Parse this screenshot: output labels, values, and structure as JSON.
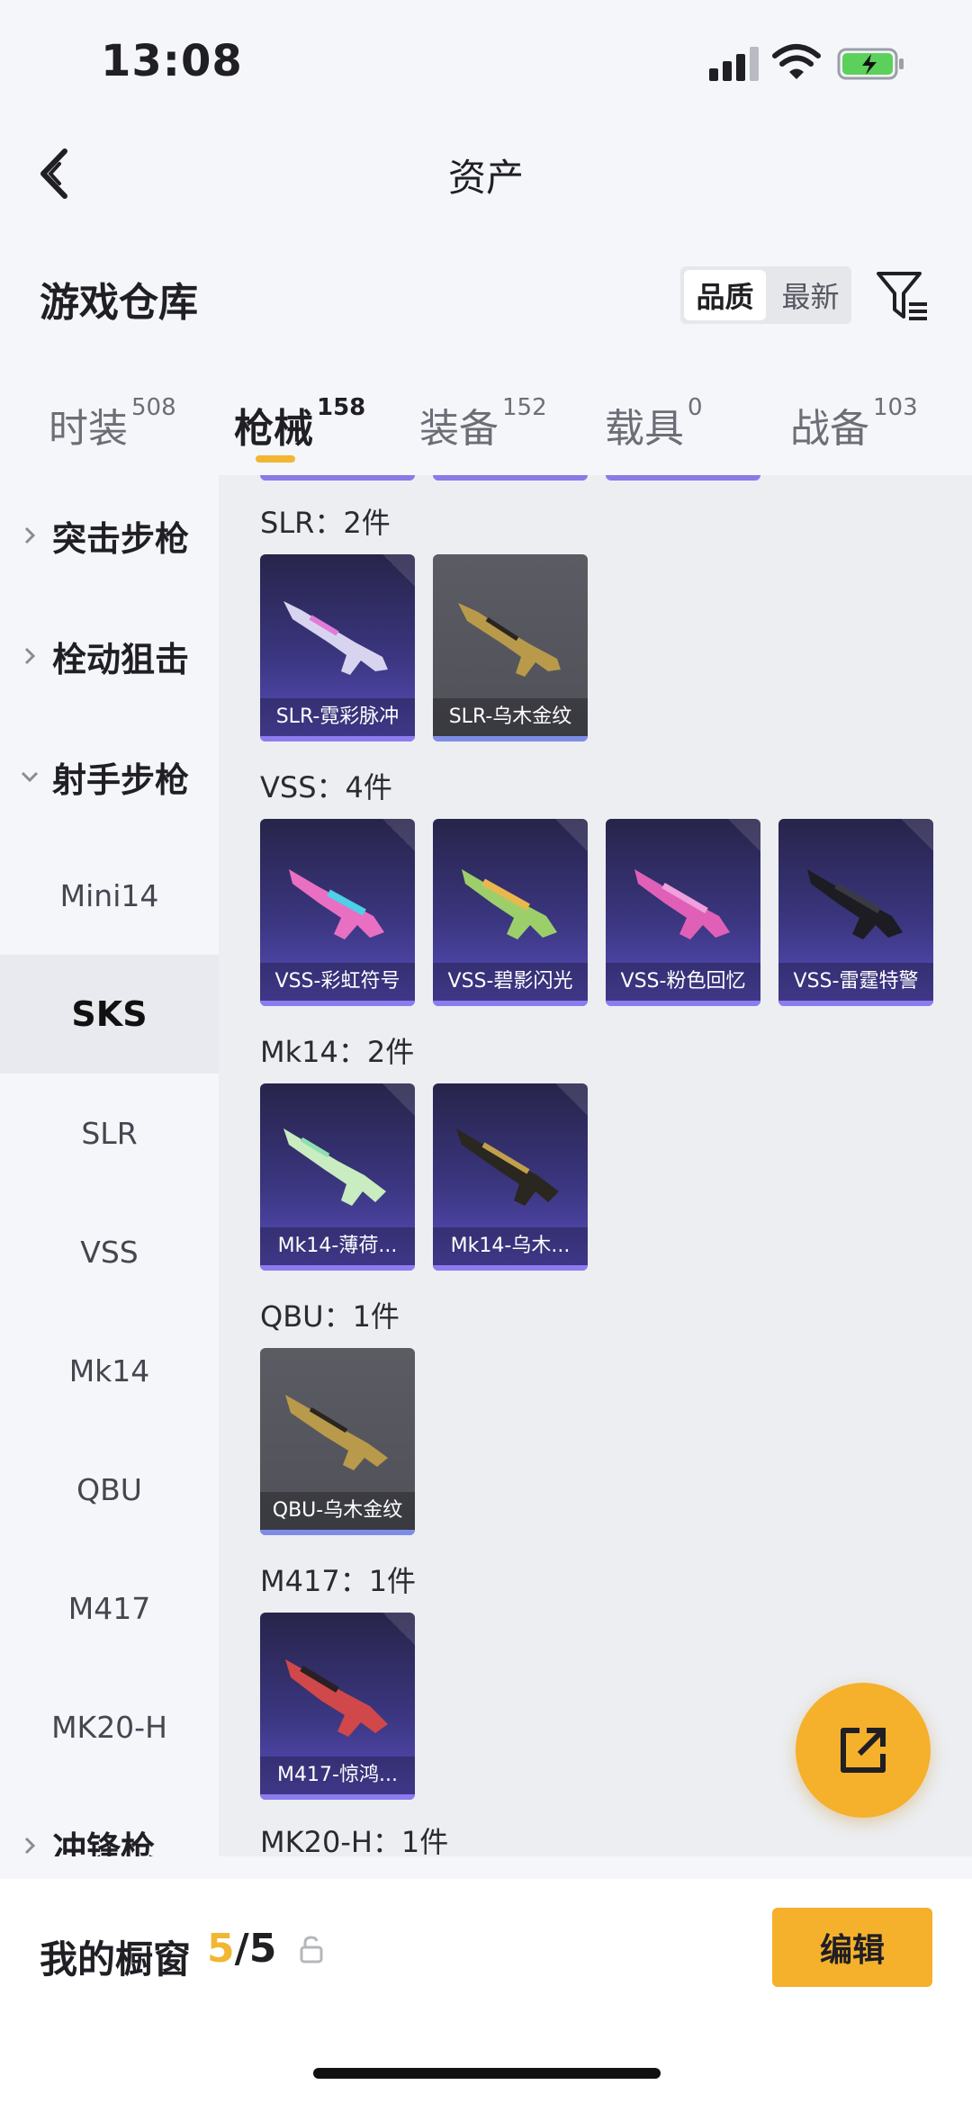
{
  "status": {
    "time": "13:08"
  },
  "nav": {
    "title": "资产"
  },
  "header": {
    "title": "游戏仓库",
    "sort": [
      "品质",
      "最新"
    ]
  },
  "tabs": [
    {
      "label": "时装",
      "count": "508"
    },
    {
      "label": "枪械",
      "count": "158"
    },
    {
      "label": "装备",
      "count": "152"
    },
    {
      "label": "载具",
      "count": "0"
    },
    {
      "label": "战备",
      "count": "103"
    }
  ],
  "sidebar": {
    "groups": [
      "突击步枪",
      "栓动狙击",
      "射手步枪",
      "冲锋枪"
    ],
    "subs": [
      "Mini14",
      "SKS",
      "SLR",
      "VSS",
      "Mk14",
      "QBU",
      "M417",
      "MK20-H"
    ]
  },
  "sections": [
    {
      "title": "SLR：2件",
      "items": [
        "SLR-霓彩脉冲",
        "SLR-乌木金纹"
      ]
    },
    {
      "title": "VSS：4件",
      "items": [
        "VSS-彩虹符号",
        "VSS-碧影闪光",
        "VSS-粉色回忆",
        "VSS-雷霆特警"
      ]
    },
    {
      "title": "Mk14：2件",
      "items": [
        "Mk14-薄荷...",
        "Mk14-乌木..."
      ]
    },
    {
      "title": "QBU：1件",
      "items": [
        "QBU-乌木金纹"
      ]
    },
    {
      "title": "M417：1件",
      "items": [
        "M417-惊鸿..."
      ]
    },
    {
      "title": "MK20-H：1件",
      "items": []
    }
  ],
  "bottom": {
    "title": "我的橱窗",
    "count_current": "5",
    "count_total": "/5",
    "edit_label": "编辑"
  },
  "colors": {
    "accent": "#f5b02c",
    "indicator": "#f2b633"
  }
}
